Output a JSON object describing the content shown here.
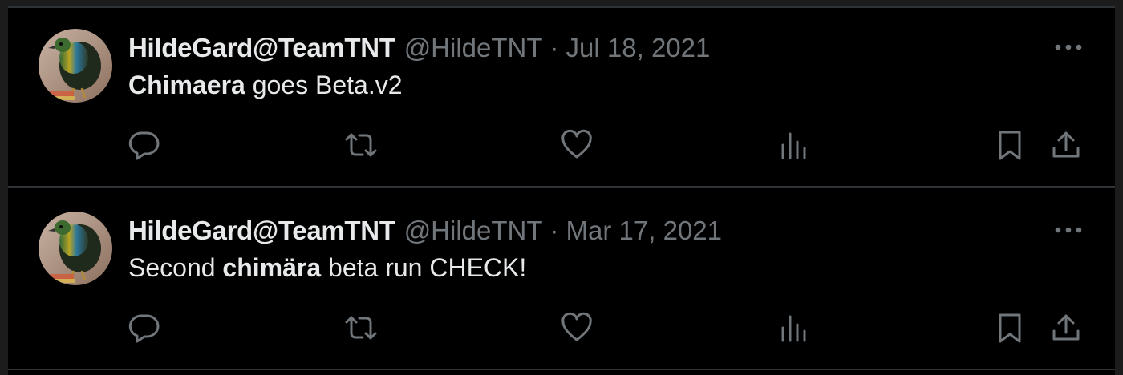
{
  "tweets": [
    {
      "display_name": "HildeGard@TeamTNT",
      "handle": "@HildeTNT",
      "separator": "·",
      "date": "Jul 18, 2021",
      "text_parts": [
        {
          "text": "Chimaera",
          "bold": true
        },
        {
          "text": " goes Beta.v2",
          "bold": false
        }
      ]
    },
    {
      "display_name": "HildeGard@TeamTNT",
      "handle": "@HildeTNT",
      "separator": "·",
      "date": "Mar 17, 2021",
      "text_parts": [
        {
          "text": "Second ",
          "bold": false
        },
        {
          "text": "chimära",
          "bold": true
        },
        {
          "text": " beta run CHECK!",
          "bold": false
        }
      ]
    }
  ],
  "icons": {
    "more": "more-dots-icon",
    "reply": "reply-icon",
    "retweet": "retweet-icon",
    "like": "heart-icon",
    "views": "views-bar-chart-icon",
    "bookmark": "bookmark-icon",
    "share": "share-icon"
  },
  "colors": {
    "background": "#000000",
    "text_primary": "#e7e9ea",
    "text_secondary": "#71767b",
    "divider": "#2f3336"
  }
}
